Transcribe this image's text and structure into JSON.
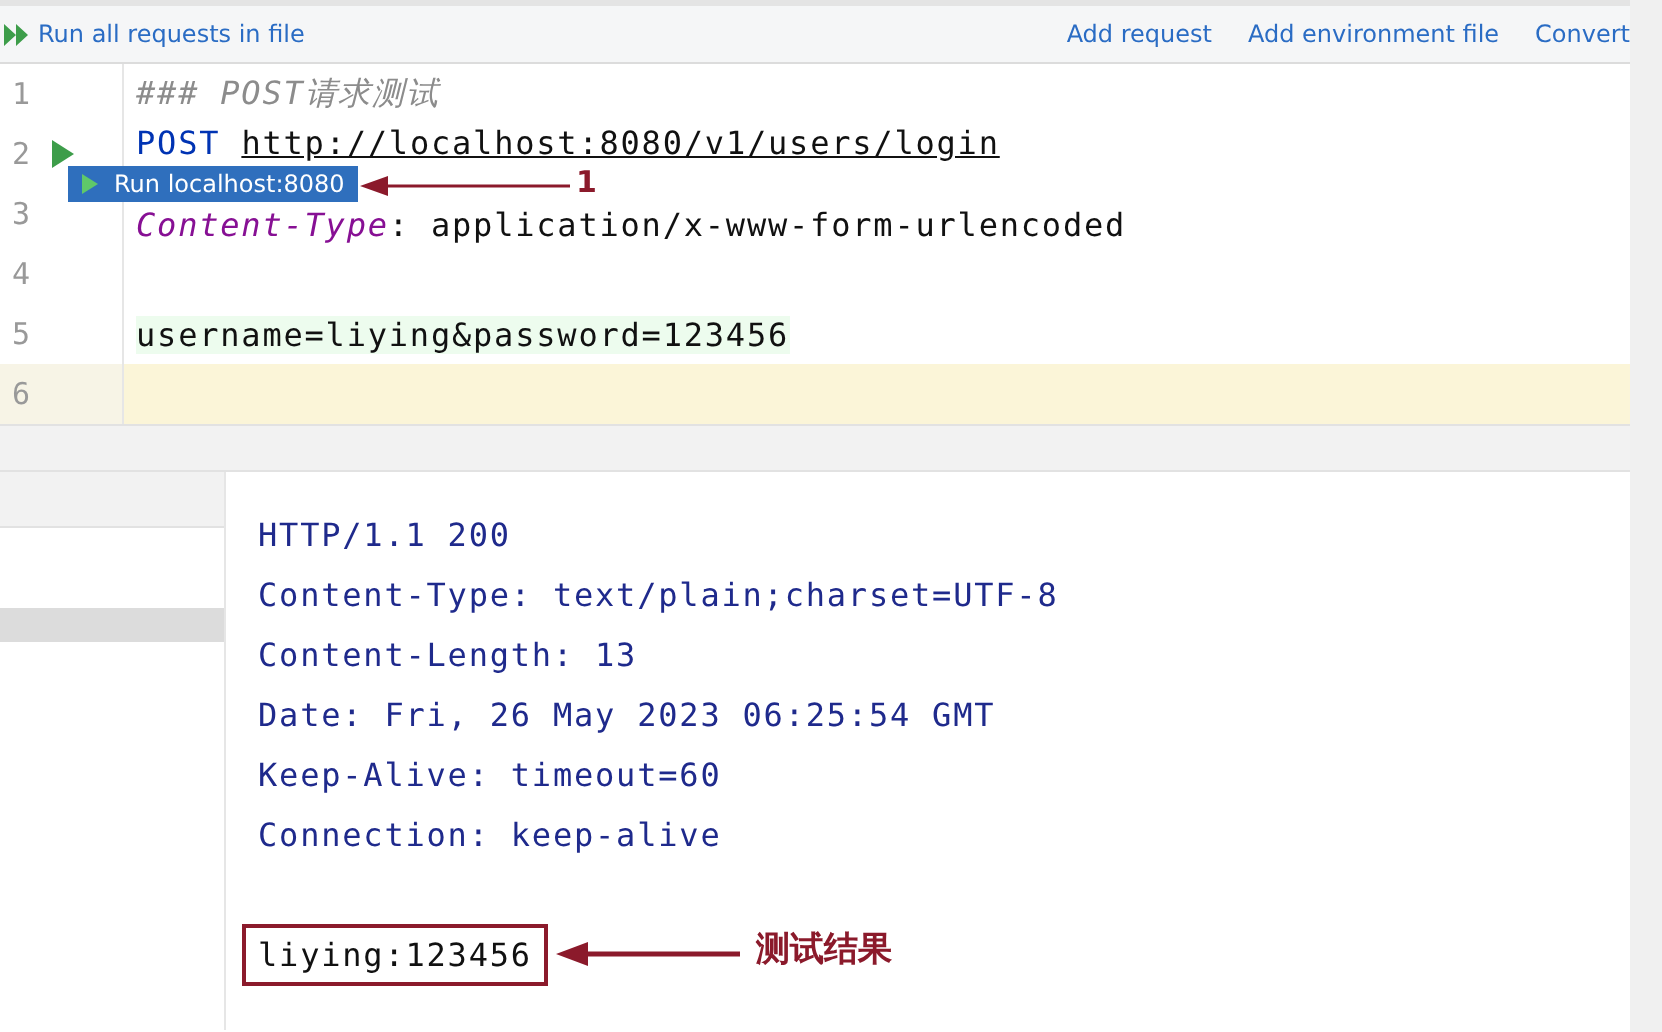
{
  "toolbar": {
    "run_all": "Run all requests in file",
    "links": [
      "Add request",
      "Add environment file",
      "Convert"
    ]
  },
  "editor": {
    "lines": [
      {
        "number": "1",
        "kind": "comment",
        "text": "### POST请求测试",
        "run": false,
        "current": false
      },
      {
        "number": "2",
        "kind": "request",
        "method": "POST",
        "url": "http://localhost:8080/v1/users/login",
        "run": true,
        "current": false
      },
      {
        "number": "3",
        "kind": "header",
        "name": "Content-Type",
        "rest": ": application/x-www-form-urlencoded",
        "run": false,
        "current": false
      },
      {
        "number": "4",
        "kind": "blank",
        "run": false,
        "current": false
      },
      {
        "number": "5",
        "kind": "body",
        "text": "username=liying&password=123456",
        "run": false,
        "current": false
      },
      {
        "number": "6",
        "kind": "blank",
        "run": false,
        "current": true
      }
    ]
  },
  "run_popup": {
    "label": "Run localhost:8080"
  },
  "response": {
    "lines": [
      "HTTP/1.1 200",
      "Content-Type: text/plain;charset=UTF-8",
      "Content-Length: 13",
      "Date: Fri, 26 May 2023 06:25:54 GMT",
      "Keep-Alive: timeout=60",
      "Connection: keep-alive"
    ],
    "body": "liying:123456"
  },
  "annotations": [
    {
      "kind": "step",
      "label": "1"
    },
    {
      "kind": "result",
      "label": "测试结果"
    }
  ]
}
